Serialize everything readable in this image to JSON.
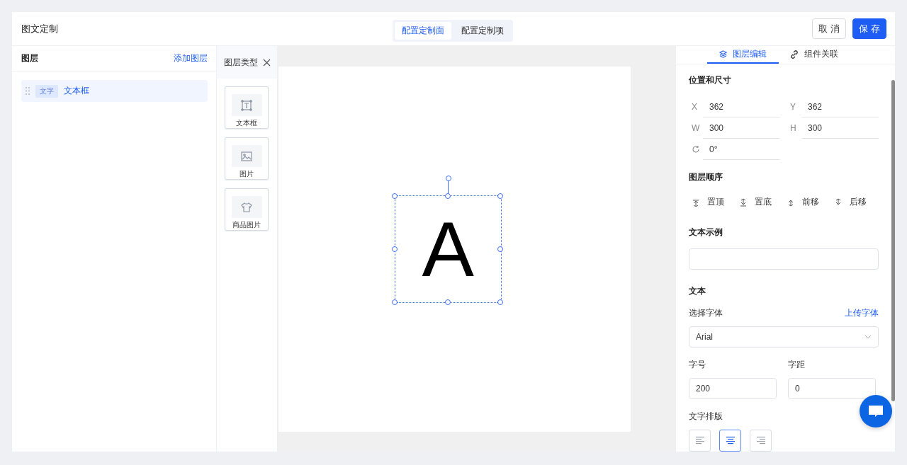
{
  "header": {
    "title": "图文定制",
    "tabs": [
      {
        "label": "配置定制面",
        "selected": true
      },
      {
        "label": "配置定制项",
        "selected": false
      }
    ],
    "buttons": [
      {
        "label": "取 消",
        "kind": "secondary"
      },
      {
        "label": "保 存",
        "kind": "primary"
      }
    ]
  },
  "layers": {
    "title": "图层",
    "action": "添加图层",
    "items": [
      {
        "tag": "文字",
        "name": "文本框",
        "selected": true
      }
    ]
  },
  "layer_types": {
    "title": "图层类型",
    "items": [
      {
        "label": "文本框",
        "kind": "text"
      },
      {
        "label": "图片",
        "kind": "image"
      },
      {
        "label": "商品图片",
        "kind": "product"
      }
    ]
  },
  "canvas": {
    "element": {
      "text": "A",
      "selected": true
    }
  },
  "inspector": {
    "tabs": [
      {
        "label": "图层编辑",
        "kind": "layers",
        "selected": true
      },
      {
        "label": "组件关联",
        "kind": "link",
        "selected": false
      }
    ],
    "position": {
      "title": "位置和尺寸",
      "fields": [
        {
          "kind": "label",
          "label": "X",
          "value": "362"
        },
        {
          "kind": "label",
          "label": "Y",
          "value": "362"
        },
        {
          "kind": "label",
          "label": "W",
          "value": "300"
        },
        {
          "kind": "label",
          "label": "H",
          "value": "300"
        },
        {
          "kind": "rotation",
          "value": "0°"
        }
      ]
    },
    "order": {
      "title": "图层顺序",
      "actions": [
        {
          "label": "置顶",
          "kind": "top"
        },
        {
          "label": "置底",
          "kind": "bottom"
        },
        {
          "label": "前移",
          "kind": "forward"
        },
        {
          "label": "后移",
          "kind": "backward"
        }
      ]
    },
    "sample": {
      "title": "文本示例"
    },
    "text": {
      "title": "文本",
      "font_label": "选择字体",
      "upload": "上传字体",
      "font": "Arial",
      "size_label": "字号",
      "size": "200",
      "spacing_label": "字距",
      "spacing": "0",
      "align_label": "文字排版",
      "align": [
        {
          "kind": "left",
          "selected": false
        },
        {
          "kind": "center",
          "selected": true
        },
        {
          "kind": "right",
          "selected": false
        }
      ]
    }
  }
}
